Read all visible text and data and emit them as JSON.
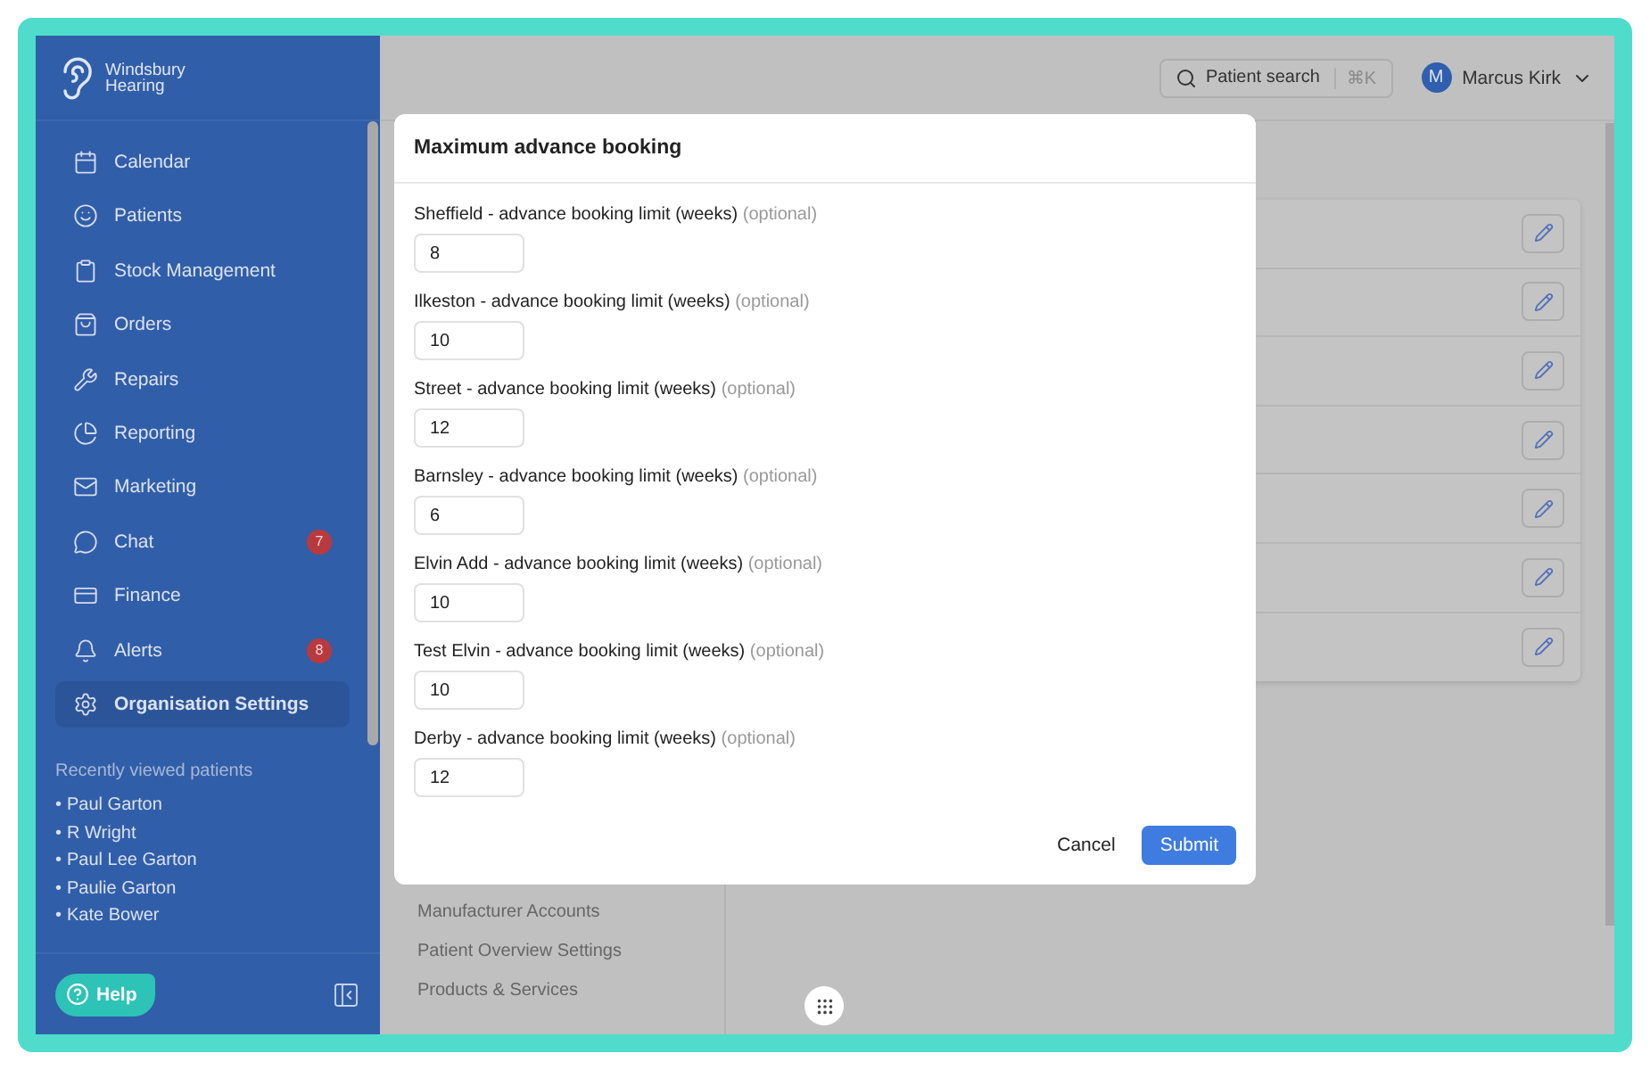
{
  "brand": {
    "lines": [
      "Windsbury",
      "Hearing"
    ]
  },
  "sidebar": {
    "items": [
      {
        "label": "Calendar",
        "selected": false
      },
      {
        "label": "Patients",
        "selected": false
      },
      {
        "label": "Stock Management",
        "selected": false
      },
      {
        "label": "Orders",
        "selected": false
      },
      {
        "label": "Repairs",
        "selected": false
      },
      {
        "label": "Reporting",
        "selected": false
      },
      {
        "label": "Marketing",
        "selected": false
      },
      {
        "label": "Chat",
        "selected": false,
        "badge": "7"
      },
      {
        "label": "Finance",
        "selected": false
      },
      {
        "label": "Alerts",
        "selected": false,
        "badge": "8"
      },
      {
        "label": "Organisation Settings",
        "selected": true
      }
    ]
  },
  "recently_viewed": {
    "title": "Recently viewed patients",
    "bullet": "•",
    "patients": [
      "Paul Garton",
      "R Wright",
      "Paul Lee Garton",
      "Paulie Garton",
      "Kate Bower"
    ]
  },
  "help_button": {
    "label": "Help"
  },
  "topbar": {
    "search": {
      "label": "Patient search",
      "shortcut": "⌘K"
    },
    "user": {
      "initial": "M",
      "name": "Marcus Kirk"
    }
  },
  "settings_nav": {
    "items": [
      "Manufacturer Accounts",
      "Patient Overview Settings",
      "Products & Services"
    ]
  },
  "modal": {
    "title": "Maximum advance booking",
    "fields": [
      {
        "label": "Sheffield - advance booking limit (weeks)",
        "hint": "(optional)",
        "value": "8"
      },
      {
        "label": "Ilkeston - advance booking limit (weeks)",
        "hint": "(optional)",
        "value": "10"
      },
      {
        "label": "Street - advance booking limit (weeks)",
        "hint": "(optional)",
        "value": "12"
      },
      {
        "label": "Barnsley - advance booking limit (weeks)",
        "hint": "(optional)",
        "value": "6"
      },
      {
        "label": "Elvin Add - advance booking limit (weeks)",
        "hint": "(optional)",
        "value": "10"
      },
      {
        "label": "Test Elvin - advance booking limit (weeks)",
        "hint": "(optional)",
        "value": "10"
      },
      {
        "label": "Derby - advance booking limit (weeks)",
        "hint": "(optional)",
        "value": "12"
      }
    ],
    "cancel": "Cancel",
    "submit": "Submit"
  }
}
